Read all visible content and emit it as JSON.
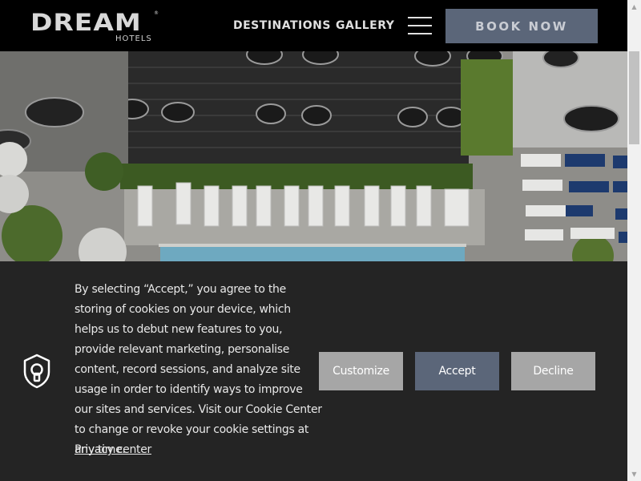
{
  "header": {
    "logo_word": "DREAM",
    "logo_sub": "HOTELS",
    "logo_mark": "®",
    "nav": [
      "DESTINATIONS",
      "GALLERY"
    ],
    "menu_icon": "hamburger-menu-icon",
    "book_label": "BOOK NOW"
  },
  "hero": {
    "description_icon": "photo"
  },
  "cookie": {
    "icon": "shield-keyhole-icon",
    "text": "By selecting “Accept,” you agree to the storing of cookies on your device, which helps us to debut new features to you, provide relevant marketing, personalise content, record sessions, and analyze site usage in order to identify ways to improve our sites and services. Visit our Cookie Center to change or revoke your cookie settings at any time.",
    "privacy_link": "Privacy center",
    "buttons": {
      "customize": "Customize",
      "accept": "Accept",
      "decline": "Decline"
    }
  },
  "colors": {
    "accent": "#5b6679",
    "banner_bg": "#242424",
    "secondary_button": "#a6a6a6"
  }
}
